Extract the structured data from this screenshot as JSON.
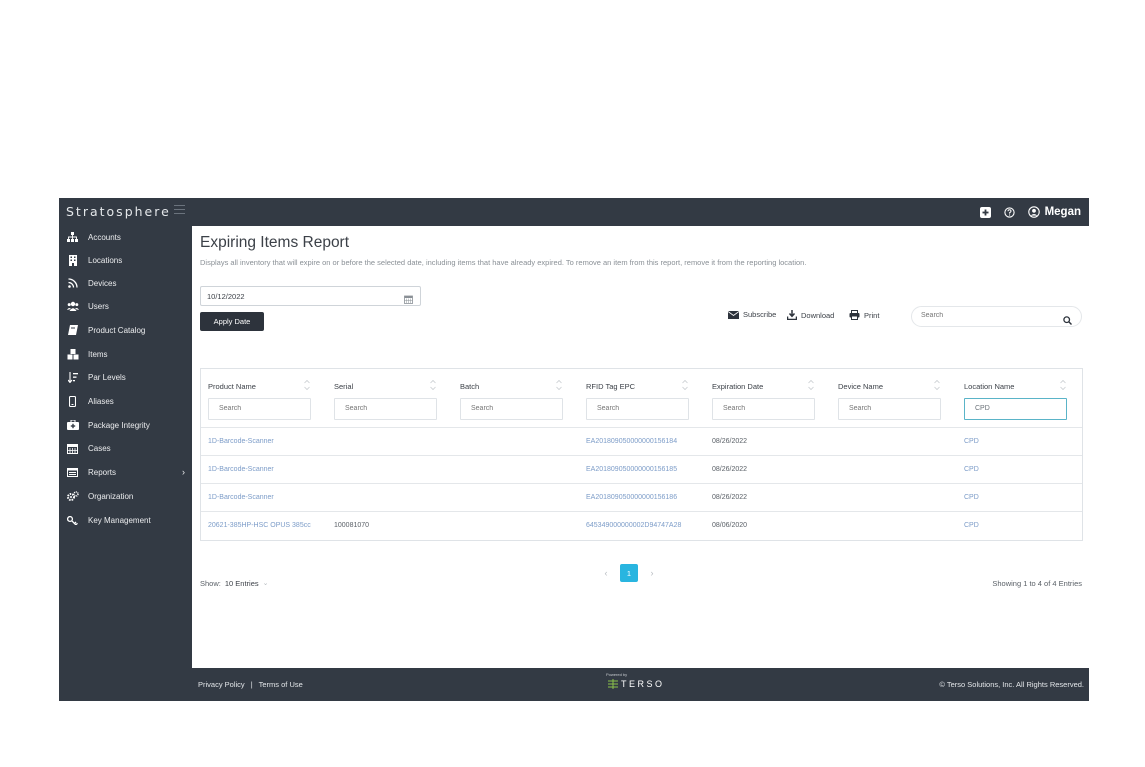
{
  "app": {
    "brand": "Stratosphere",
    "user_name": "Megan"
  },
  "sidebar": {
    "items": [
      {
        "label": "Accounts",
        "icon": "sitemap-icon"
      },
      {
        "label": "Locations",
        "icon": "building-icon"
      },
      {
        "label": "Devices",
        "icon": "rss-icon"
      },
      {
        "label": "Users",
        "icon": "users-icon"
      },
      {
        "label": "Product Catalog",
        "icon": "book-icon"
      },
      {
        "label": "Items",
        "icon": "cubes-icon"
      },
      {
        "label": "Par Levels",
        "icon": "sort-amount-icon"
      },
      {
        "label": "Aliases",
        "icon": "mobile-icon"
      },
      {
        "label": "Package Integrity",
        "icon": "medkit-icon"
      },
      {
        "label": "Cases",
        "icon": "calendar-icon"
      },
      {
        "label": "Reports",
        "icon": "list-alt-icon"
      },
      {
        "label": "Organization",
        "icon": "cogs-icon"
      },
      {
        "label": "Key Management",
        "icon": "key-icon"
      }
    ]
  },
  "page": {
    "title": "Expiring Items Report",
    "description": "Displays all inventory that will expire on or before the selected date, including items that have already expired. To remove an item from this report, remove it from the reporting location.",
    "date_value": "10/12/2022",
    "apply_label": "Apply Date",
    "subscribe_label": "Subscribe",
    "download_label": "Download",
    "print_label": "Print",
    "search_placeholder": "Search"
  },
  "table": {
    "columns": [
      "Product Name",
      "Serial",
      "Batch",
      "RFID Tag EPC",
      "Expiration Date",
      "Device Name",
      "Location Name"
    ],
    "search_placeholder": "Search",
    "location_filter": "CPD",
    "rows": [
      [
        "1D-Barcode-Scanner",
        "",
        "",
        "EA201809050000000156184",
        "08/26/2022",
        "",
        "CPD"
      ],
      [
        "1D-Barcode-Scanner",
        "",
        "",
        "EA201809050000000156185",
        "08/26/2022",
        "",
        "CPD"
      ],
      [
        "1D-Barcode-Scanner",
        "",
        "",
        "EA201809050000000156186",
        "08/26/2022",
        "",
        "CPD"
      ],
      [
        "20621-385HP-HSC OPUS 385cc",
        "100081070",
        "",
        "645349000000002D94747A28",
        "08/06/2020",
        "",
        "CPD"
      ]
    ]
  },
  "pagination": {
    "show_label": "Show:",
    "entries_label": "10 Entries",
    "current_page": "1",
    "prev": "‹",
    "next": "›",
    "showing_text": "Showing 1 to 4 of 4 Entries"
  },
  "footer": {
    "privacy": "Privacy Policy",
    "separator": "|",
    "terms": "Terms of Use",
    "powered_by": "Powered by",
    "logo_text": "TERSO",
    "copyright": "© Terso Solutions, Inc. All Rights Reserved."
  }
}
